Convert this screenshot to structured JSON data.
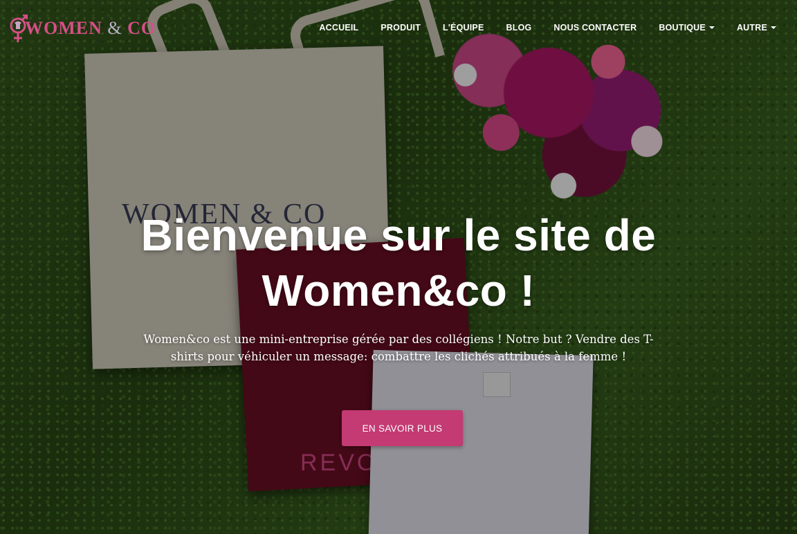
{
  "brand": {
    "logo_text_women": "WOMEN",
    "logo_text_amp": "&",
    "logo_text_co": "CO",
    "logo_color": "#d64f88",
    "logo_symbol_icon": "gender-symbol-icon"
  },
  "nav": {
    "items": [
      {
        "label": "ACCUEIL",
        "dropdown": false
      },
      {
        "label": "PRODUIT",
        "dropdown": false
      },
      {
        "label": "L'ÉQUIPE",
        "dropdown": false
      },
      {
        "label": "BLOG",
        "dropdown": false
      },
      {
        "label": "NOUS CONTACTER",
        "dropdown": false
      },
      {
        "label": "BOUTIQUE",
        "dropdown": true
      },
      {
        "label": "AUTRE",
        "dropdown": true
      }
    ],
    "text_color": "#ffffff"
  },
  "hero": {
    "title": "Bienvenue sur le site de Women&co !",
    "subtitle": "Women&co est une mini-entreprise gérée par des collégiens ! Notre but ? Vendre des T-shirts pour véhiculer un message: combattre les clichés attribués à la femme !",
    "cta_label": "EN SAVOIR PLUS",
    "cta_color": "#c43a73",
    "tote_print": "WOMEN & CO",
    "tshirt_print": "REVOL"
  }
}
